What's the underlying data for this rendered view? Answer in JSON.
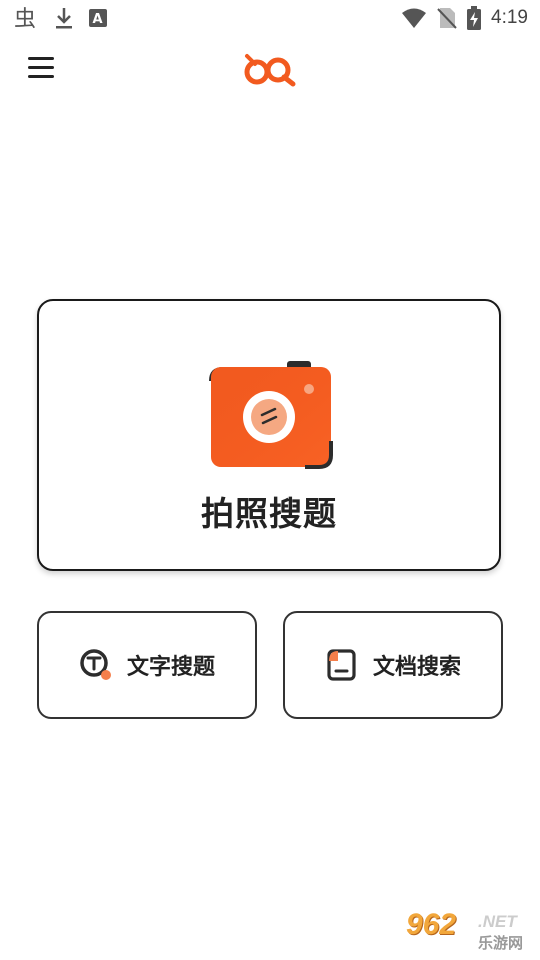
{
  "status_bar": {
    "time": "4:19",
    "icons": [
      "bug-icon",
      "download-icon",
      "font-icon",
      "wifi-icon",
      "no-sim-icon",
      "battery-charging-icon"
    ]
  },
  "header": {
    "menu_icon": "hamburger-menu-icon",
    "logo_icon": "app-logo",
    "brand_color": "#f25a1f"
  },
  "main": {
    "photo_search": {
      "label": "拍照搜题",
      "icon": "camera-icon"
    },
    "text_search": {
      "label": "文字搜题",
      "icon": "text-search-icon"
    },
    "doc_search": {
      "label": "文档搜索",
      "icon": "document-icon"
    }
  },
  "watermark": {
    "main": "962",
    "net": ".NET",
    "sub": "乐游网"
  }
}
